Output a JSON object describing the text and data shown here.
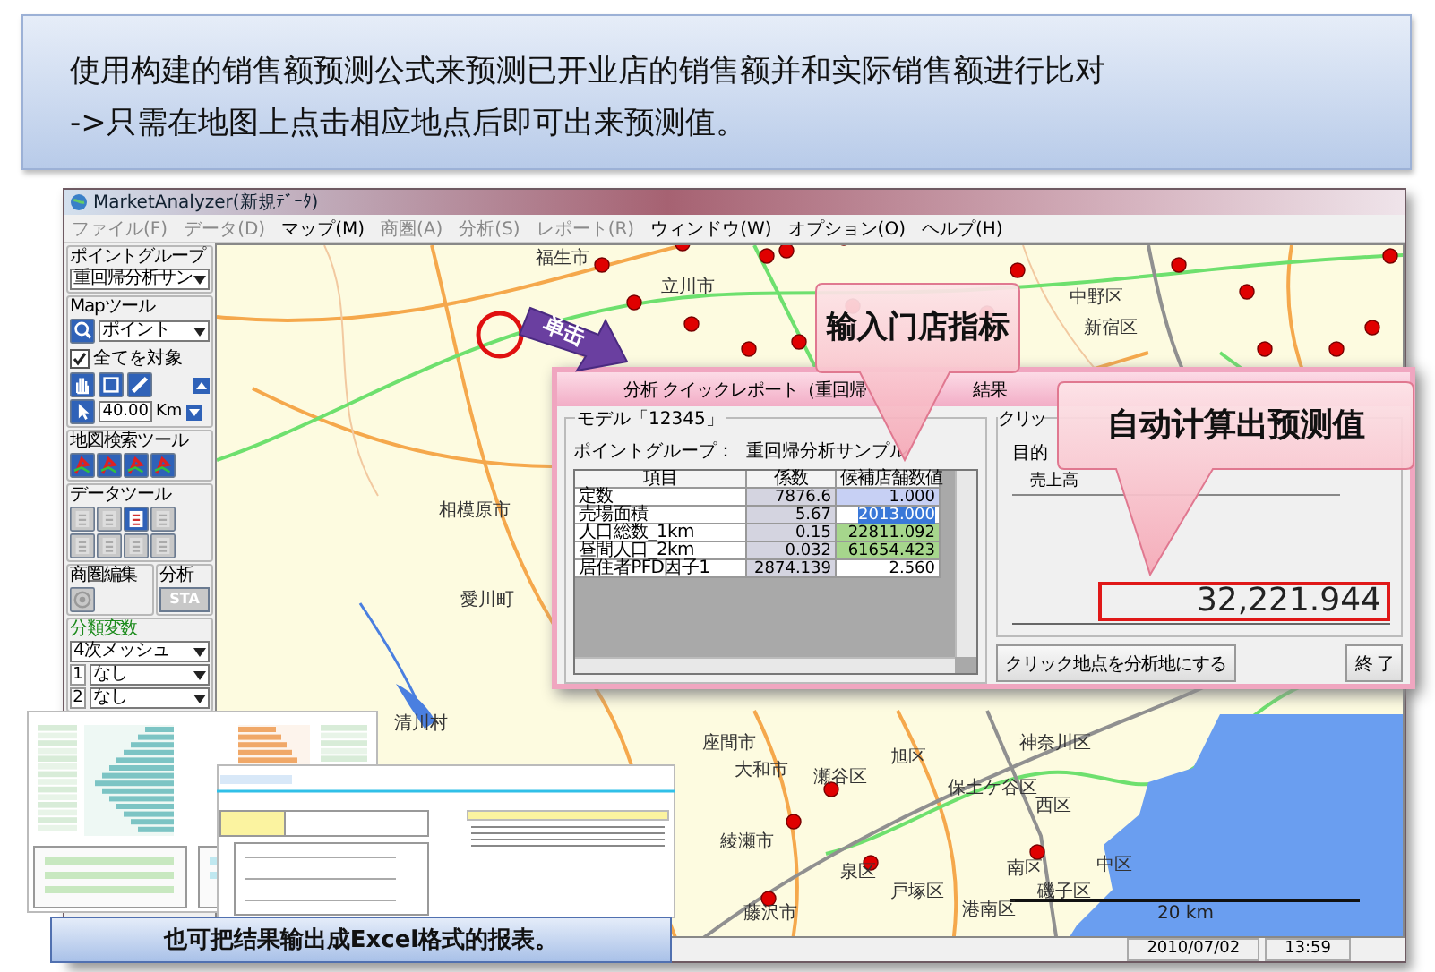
{
  "banner": {
    "lines": [
      "使用构建的销售额预测公式来预测已开业店的销售额并和实际销售额进行比对",
      "->只需在地图上点击相应地点后即可出来预测值。"
    ]
  },
  "app": {
    "title": "MarketAnalyzer(新規ﾃﾞｰﾀ)",
    "menu": [
      {
        "label": "ファイル(F)",
        "disabled": true
      },
      {
        "label": "データ(D)",
        "disabled": true
      },
      {
        "label": "マップ(M)",
        "disabled": false
      },
      {
        "label": "商圏(A)",
        "disabled": true
      },
      {
        "label": "分析(S)",
        "disabled": true
      },
      {
        "label": "レポート(R)",
        "disabled": true
      },
      {
        "label": "ウィンドウ(W)",
        "disabled": false
      },
      {
        "label": "オプション(O)",
        "disabled": false
      },
      {
        "label": "ヘルプ(H)",
        "disabled": false
      }
    ],
    "tool_panel": {
      "point_group": {
        "title": "ポイントグループ",
        "value": "重回帰分析サン"
      },
      "map_tools": {
        "title": "Mapツール",
        "mode": "ポイント",
        "all_targets": {
          "label": "全てを対象",
          "checked": true
        },
        "scale": "40.00",
        "unit": "Km"
      },
      "map_search_tools": {
        "title": "地図検索ツール"
      },
      "data_tools": {
        "title": "データツール",
        "buttons": [
          {
            "disabled": true
          },
          {
            "disabled": true
          },
          {
            "disabled": false
          },
          {
            "disabled": true
          },
          {
            "disabled": true
          },
          {
            "disabled": true
          },
          {
            "disabled": true
          },
          {
            "disabled": true
          }
        ]
      },
      "area_edit": {
        "title": "商圏編集"
      },
      "analysis": {
        "title": "分析",
        "button": "STA"
      },
      "class_vars": {
        "title": "分類変数",
        "mesh": "4次メッシュ",
        "rows": [
          {
            "index": "1",
            "value": "なし"
          },
          {
            "index": "2",
            "value": "なし"
          }
        ]
      }
    },
    "map": {
      "labels": [
        "福生市",
        "立川市",
        "中野区",
        "新宿区",
        "相模原市",
        "愛川町",
        "清川村",
        "座間市",
        "大和市",
        "瀬谷区",
        "旭区",
        "神奈川区",
        "保土ケ谷区",
        "西区",
        "綾瀬市",
        "泉区",
        "南区",
        "中区",
        "戸塚区",
        "港南区",
        "磯子区",
        "藤沢市"
      ],
      "scale": "20 km"
    },
    "status_bar": {
      "date": "2010/07/02",
      "time": "13:59"
    }
  },
  "dialog": {
    "title_parts": [
      "分析 クイックレポート（重回帰",
      "結果"
    ],
    "model": "モデル「12345」",
    "point_group": "ポイントグループ：  重回帰分析サンプル",
    "columns": [
      "項目",
      "係数",
      "候補店舗数値"
    ],
    "rows": [
      {
        "item": "定数",
        "coef": "7876.6",
        "value": "1.000",
        "kind": "fixed"
      },
      {
        "item": "売場面積",
        "coef": "5.67",
        "value": "2013.000",
        "kind": "editing"
      },
      {
        "item": "人口総数_1km",
        "coef": "0.15",
        "value": "22811.092",
        "kind": "derived"
      },
      {
        "item": "昼間人口_2km",
        "coef": "0.032",
        "value": "61654.423",
        "kind": "derived"
      },
      {
        "item": "居住者PFD因子1",
        "coef": "2874.139",
        "value": "2.560",
        "kind": "input"
      }
    ],
    "result_group": "クリッ",
    "target_label": "目的",
    "target_value": "売上高",
    "prediction": "32,221.944",
    "buttons": [
      "クリック地点を分析地にする",
      "終 了"
    ]
  },
  "callouts": [
    {
      "text": "输入门店指标"
    },
    {
      "text": "自动计算出预测值"
    }
  ],
  "click_arrow": {
    "label": "单击"
  },
  "caption": "也可把结果输出成Excel格式的报表。"
}
